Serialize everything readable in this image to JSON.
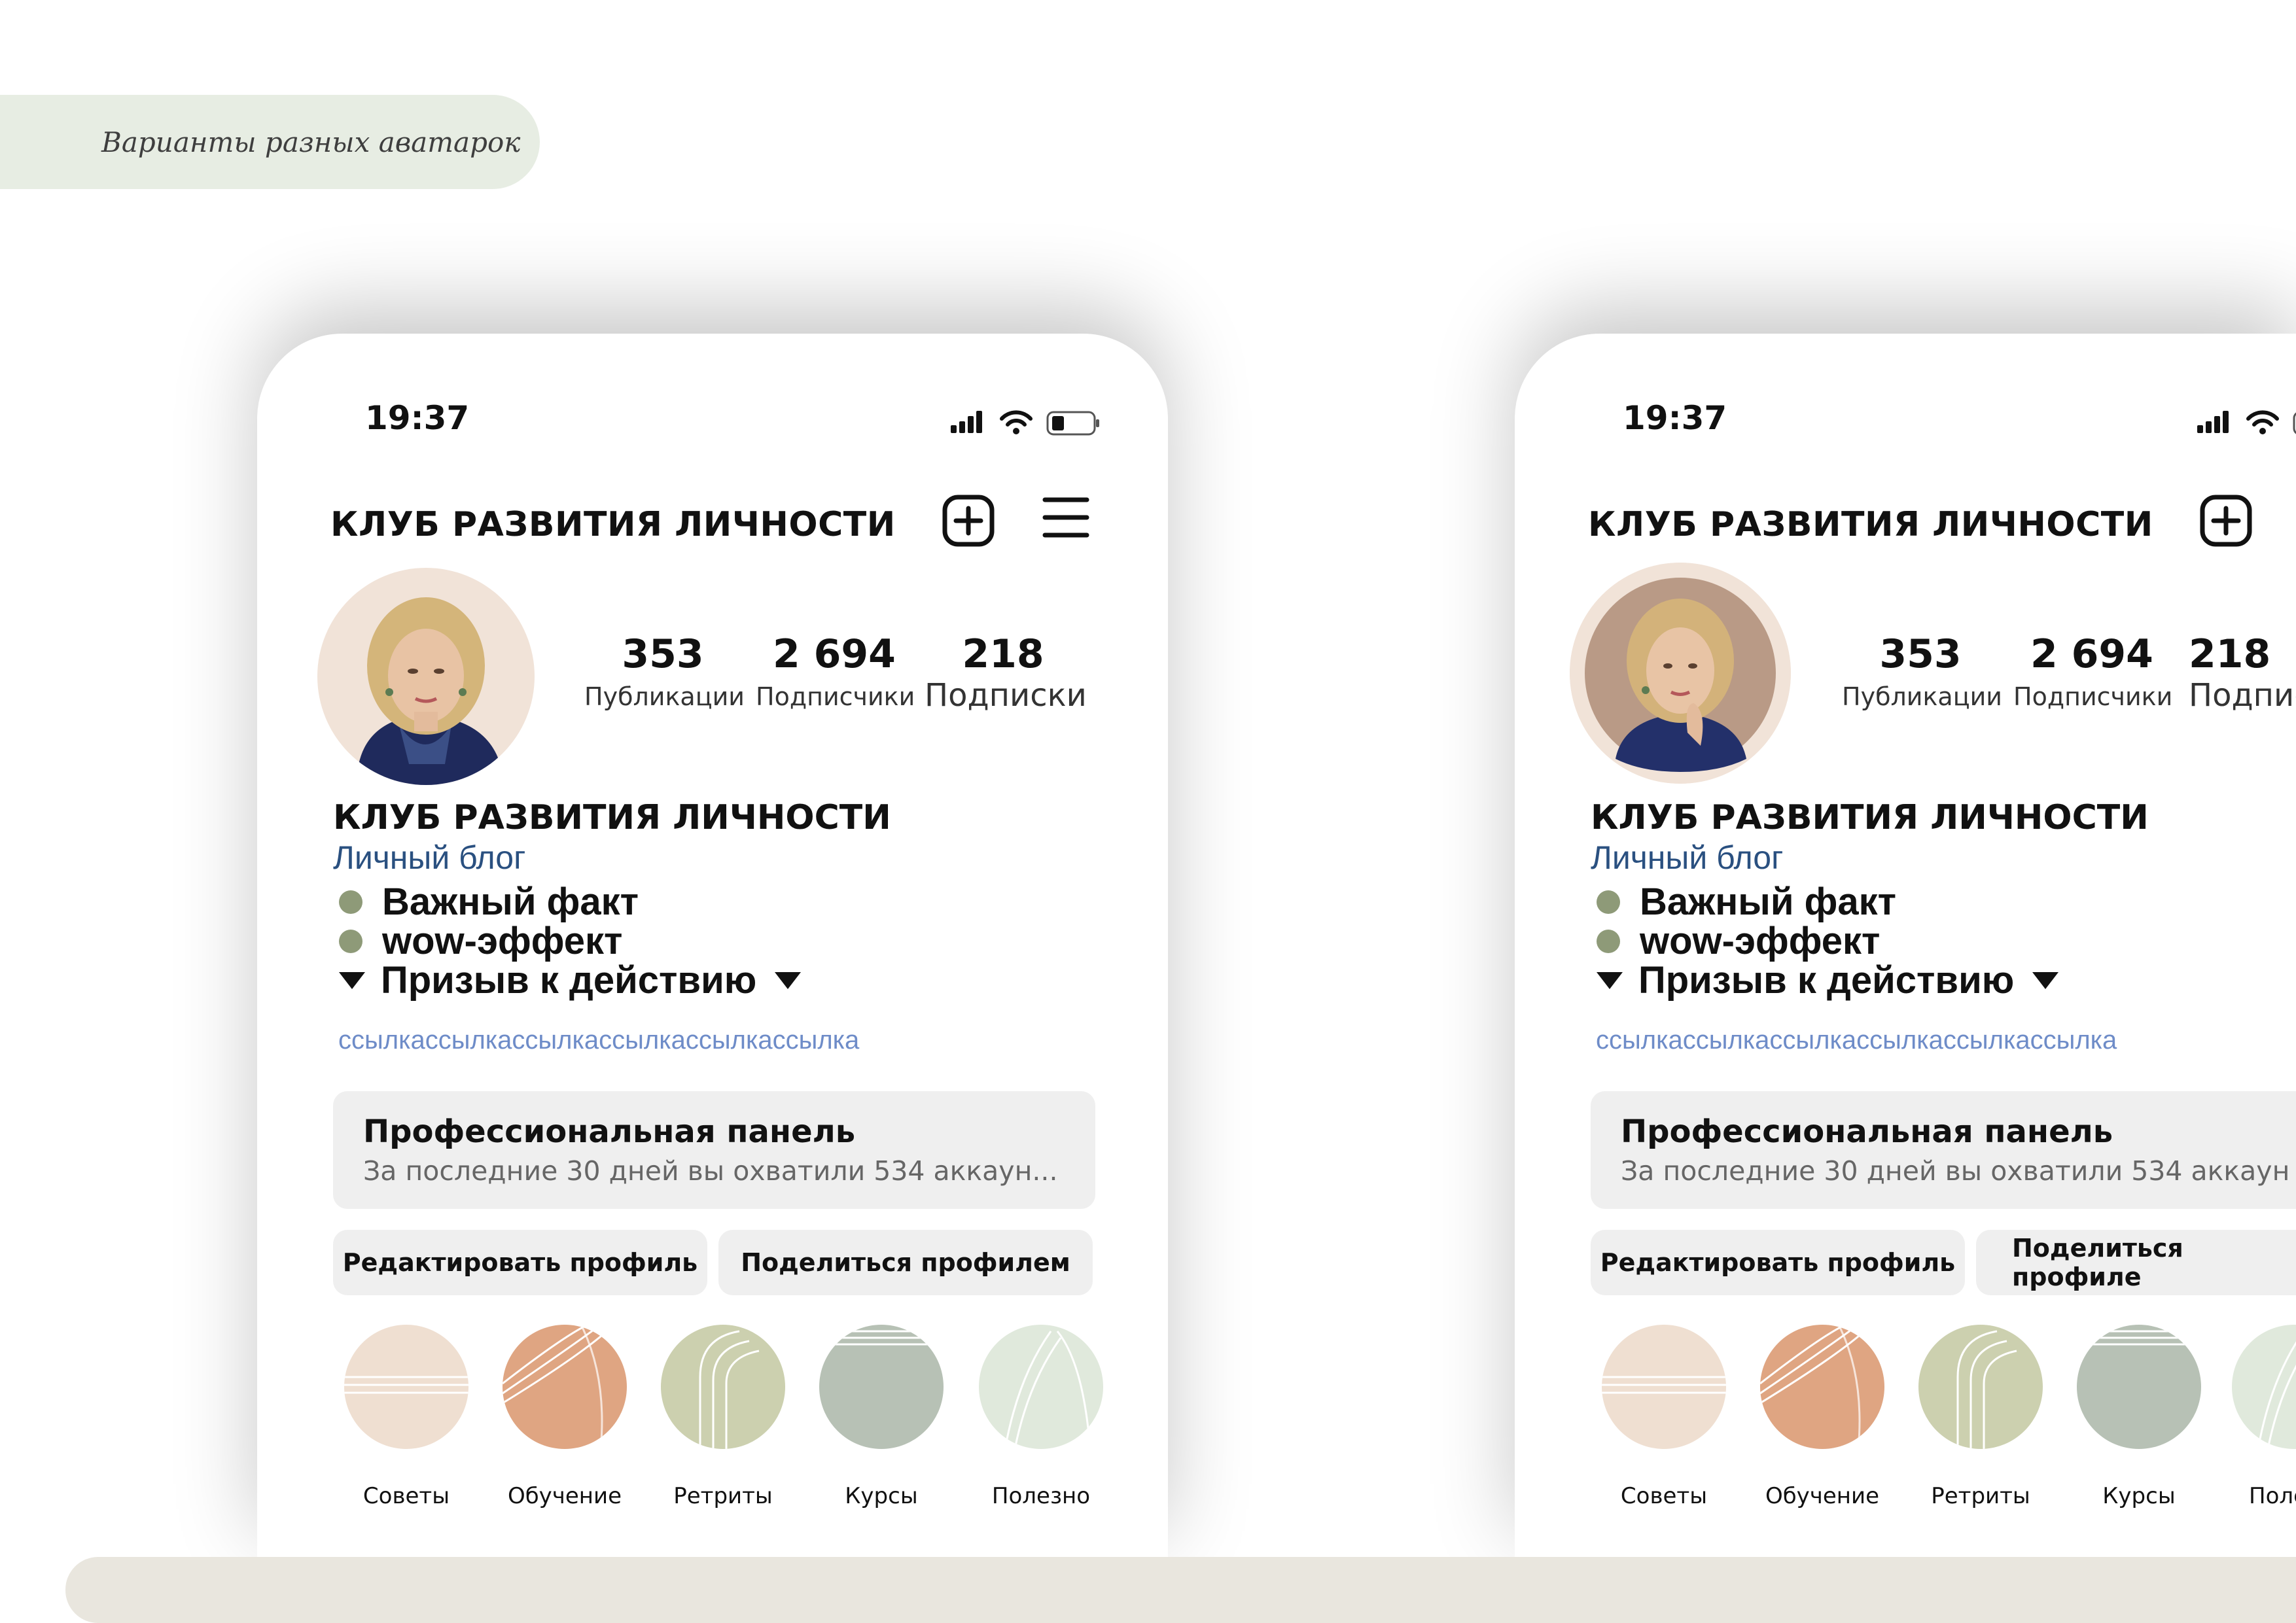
{
  "caption": "Варианты разных аватарок",
  "phones": [
    {
      "status": {
        "time": "19:37"
      },
      "header": {
        "title": "КЛУБ РАЗВИТИЯ ЛИЧНОСТИ"
      },
      "stats": [
        {
          "value": "353",
          "label": "Публикации"
        },
        {
          "value": "2 694",
          "label": "Подписчики"
        },
        {
          "value": "218",
          "label": "Подписки"
        }
      ],
      "bio": {
        "name": "КЛУБ РАЗВИТИЯ ЛИЧНОСТИ",
        "category": "Личный блог",
        "line1": "Важный факт",
        "line2": "wow-эффект",
        "line3": "Призыв к действию",
        "link": "ссылкассылкассылкассылкассылкассылка"
      },
      "pro_panel": {
        "title": "Профессиональная панель",
        "subtitle": "За последние 30 дней вы охватили 534 аккаун..."
      },
      "buttons": {
        "edit": "Редактировать профиль",
        "share": "Поделиться профилем"
      },
      "highlights": [
        {
          "label": "Советы",
          "color": "#efdfd1"
        },
        {
          "label": "Обучение",
          "color": "#dfa582"
        },
        {
          "label": "Ретриты",
          "color": "#ccd0af"
        },
        {
          "label": "Курсы",
          "color": "#b7c1b5"
        },
        {
          "label": "Полезно",
          "color": "#e0e9dc"
        }
      ]
    },
    {
      "status": {
        "time": "19:37"
      },
      "header": {
        "title": "КЛУБ РАЗВИТИЯ ЛИЧНОСТИ"
      },
      "stats": [
        {
          "value": "353",
          "label": "Публикации"
        },
        {
          "value": "2 694",
          "label": "Подписчики"
        },
        {
          "value": "218",
          "label": "Подпис"
        }
      ],
      "bio": {
        "name": "КЛУБ РАЗВИТИЯ ЛИЧНОСТИ",
        "category": "Личный блог",
        "line1": "Важный факт",
        "line2": "wow-эффект",
        "line3": "Призыв к действию",
        "link": "ссылкассылкассылкассылкассылкассылка"
      },
      "pro_panel": {
        "title": "Профессиональная панель",
        "subtitle": "За последние 30 дней вы охватили 534 аккаун"
      },
      "buttons": {
        "edit": "Редактировать профиль",
        "share": "Поделиться профиле"
      },
      "highlights": [
        {
          "label": "Советы",
          "color": "#efdfd1"
        },
        {
          "label": "Обучение",
          "color": "#dfa582"
        },
        {
          "label": "Ретриты",
          "color": "#ccd0af"
        },
        {
          "label": "Курсы",
          "color": "#b7c1b5"
        },
        {
          "label": "Поле",
          "color": "#e0e9dc"
        }
      ]
    }
  ]
}
